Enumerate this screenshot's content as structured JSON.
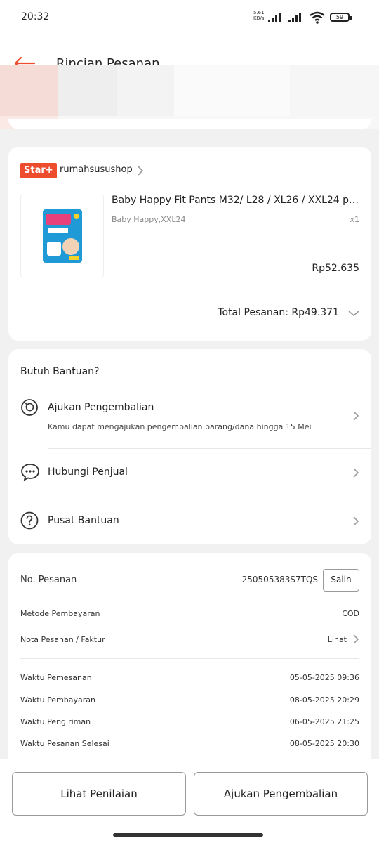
{
  "status_bar": {
    "time": "20:32",
    "net_speed": "5.61",
    "net_unit": "KB/s",
    "battery": "59"
  },
  "header": {
    "title": "Rincian Pesanan"
  },
  "shop": {
    "badge": "Star+",
    "name": "rumahsusushop",
    "product": {
      "title": "Baby Happy Fit Pants M32/ L28 / XL26 / XXL24 p…",
      "variation": "Baby Happy,XXL24",
      "qty": "x1",
      "price": "Rp52.635"
    },
    "total": "Total Pesanan: Rp49.371"
  },
  "help": {
    "title": "Butuh Bantuan?",
    "items": [
      {
        "label": "Ajukan Pengembalian",
        "sub": "Kamu dapat mengajukan pengembalian barang/dana hingga 15 Mei"
      },
      {
        "label": "Hubungi Penjual"
      },
      {
        "label": "Pusat Bantuan"
      }
    ]
  },
  "order": {
    "number_label": "No. Pesanan",
    "number": "250505383S7TQS",
    "copy": "Salin",
    "payment_label": "Metode Pembayaran",
    "payment": "COD",
    "invoice_label": "Nota Pesanan / Faktur",
    "invoice_action": "Lihat",
    "times": [
      {
        "label": "Waktu Pemesanan",
        "value": "05-05-2025 09:36"
      },
      {
        "label": "Waktu Pembayaran",
        "value": "08-05-2025 20:29"
      },
      {
        "label": "Waktu Pengiriman",
        "value": "06-05-2025 21:25"
      },
      {
        "label": "Waktu Pesanan Selesai",
        "value": "08-05-2025 20:30"
      }
    ]
  },
  "bottom": {
    "review_button": "Lihat Penilaian",
    "return_button": "Ajukan Pengembalian"
  },
  "colors": {
    "accent": "#ee4d2d"
  }
}
